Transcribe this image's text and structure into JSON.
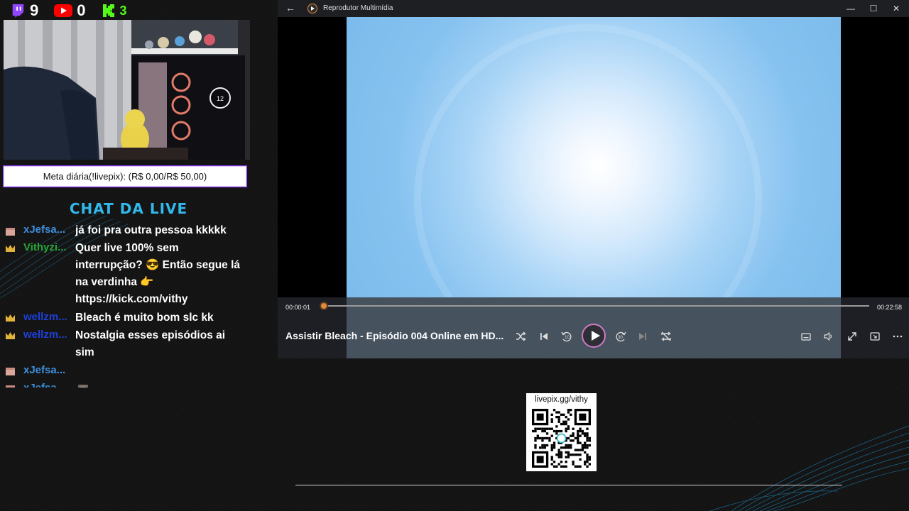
{
  "counters": [
    {
      "platform": "twitch",
      "icon": "twitch-icon",
      "value": "9",
      "color": "#9146ff"
    },
    {
      "platform": "youtube",
      "icon": "youtube-icon",
      "value": "0",
      "color": "#ff0000"
    },
    {
      "platform": "kick",
      "icon": "kick-icon",
      "value": "3",
      "color": "#53fc18"
    }
  ],
  "meta_bar": {
    "text": "Meta diária(!livepix): (R$ 0,00/R$ 50,00)"
  },
  "chat_title": {
    "part1": "CHAT",
    "part2": "DA LIVE"
  },
  "chat": {
    "messages": [
      {
        "user": "xJefsa...",
        "user_color": "#3d8fdb",
        "badge": "box-badge-icon",
        "text": "já foi pra outra pessoa kkkkk"
      },
      {
        "user": "Vithyzi...",
        "user_color": "#26a634",
        "badge": "crown-badge-icon",
        "text": "Quer live 100% sem interrupção? 😎 Então segue lá na verdinha 👉 https://kick.com/vithy"
      },
      {
        "user": "wellzm...",
        "user_color": "#1d3fd9",
        "badge": "crown-badge-icon",
        "text": "Bleach é muito bom slc kk"
      },
      {
        "user": "wellzm...",
        "user_color": "#1d3fd9",
        "badge": "crown-badge-icon",
        "text": "Nostalgia esses episódios ai sim"
      },
      {
        "user": "xJefsa...",
        "user_color": "#3d8fdb",
        "badge": "box-badge-icon",
        "text": ""
      },
      {
        "user": "xJefsa...",
        "user_color": "#3d8fdb",
        "badge": "box-badge-icon",
        "text": "",
        "emote": "emote-icon"
      }
    ]
  },
  "player": {
    "app_title": "Reprodutor Multimídia",
    "current_time": "00:00:01",
    "duration": "00:22:58",
    "progress": 0.0007,
    "video_title": "Assistir Bleach - Episódio 004 Online em HD...",
    "accent": "#e08a3c"
  },
  "qr": {
    "label": "livepix.gg/vithy"
  }
}
